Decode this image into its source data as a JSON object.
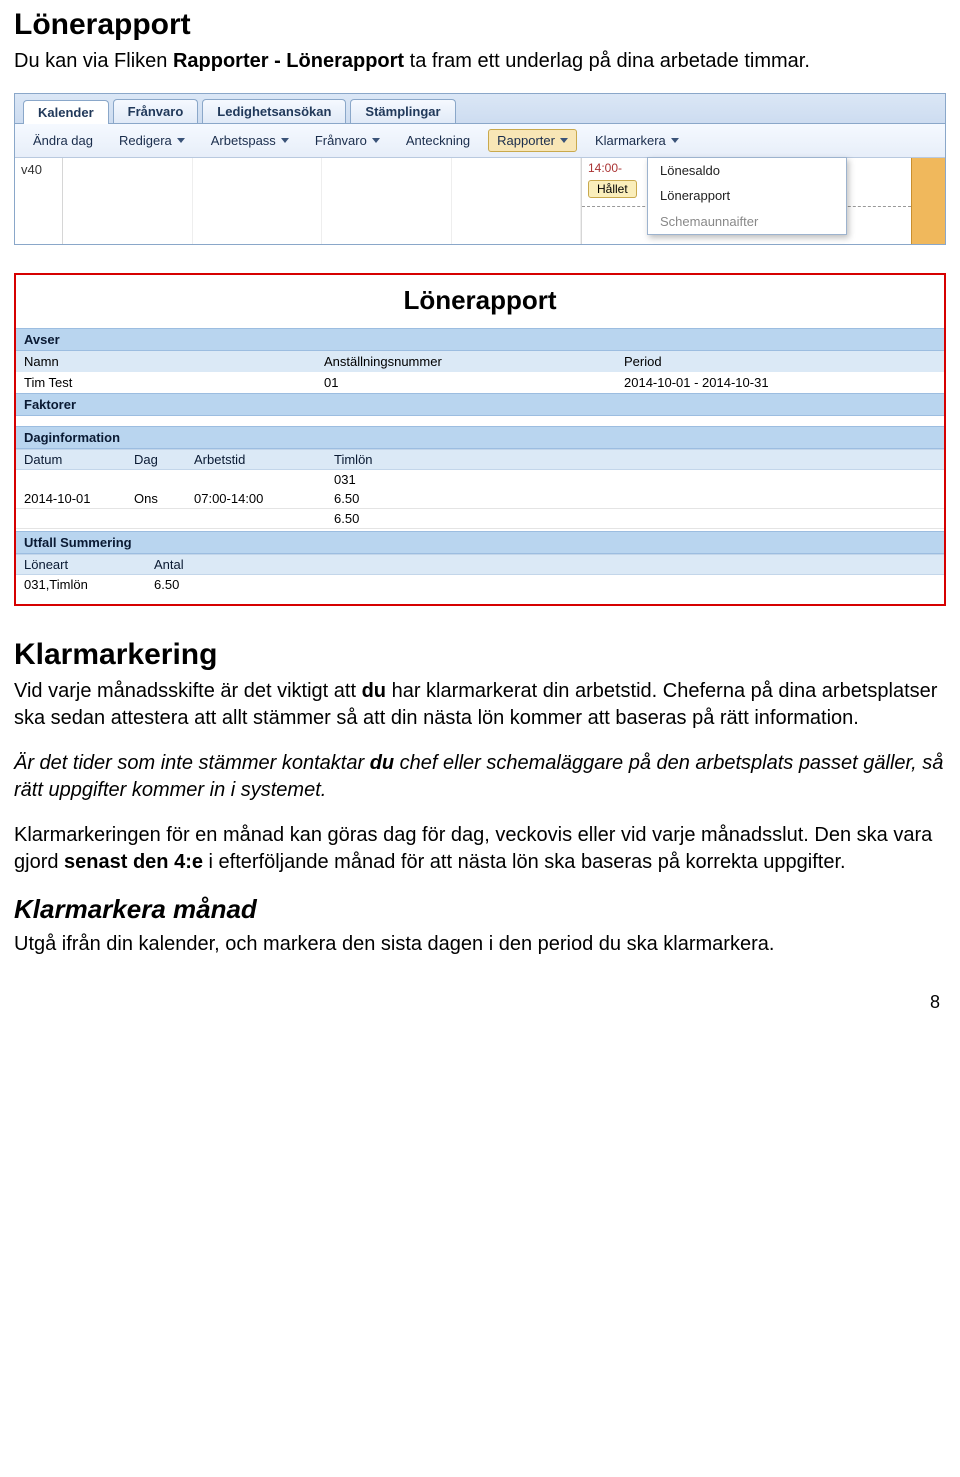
{
  "sections": {
    "lonerapport_h": "Lönerapport",
    "lonerapport_p1a": "Du kan via Fliken ",
    "lonerapport_p1b": "Rapporter - Lönerapport",
    "lonerapport_p1c": " ta fram ett underlag på dina arbetade timmar.",
    "klarmarkering_h": "Klarmarkering",
    "klar_p1a": "Vid varje månadsskifte är det viktigt att ",
    "klar_p1b": "du",
    "klar_p1c": " har klarmarkerat din arbetstid. Cheferna på dina arbetsplatser ska sedan attestera att allt stämmer så att din nästa lön kommer att baseras på rätt information.",
    "klar_p2a": "Är det tider som inte stämmer kontaktar ",
    "klar_p2b": "du",
    "klar_p2c": " chef eller schemaläggare på den arbetsplats passet gäller, så rätt uppgifter kommer in i systemet.",
    "klar_p3a": "Klarmarkeringen för en månad kan göras dag för dag, veckovis eller vid varje månadsslut. Den ska vara gjord ",
    "klar_p3b": "senast den 4:e",
    "klar_p3c": " i efterföljande månad för att nästa lön ska baseras på korrekta uppgifter.",
    "klarmanad_h": "Klarmarkera månad",
    "klarmanad_p": "Utgå ifrån din kalender, och markera den sista dagen i den period du ska klarmarkera."
  },
  "app1": {
    "tabs": [
      "Kalender",
      "Frånvaro",
      "Ledighetsansökan",
      "Stämplingar"
    ],
    "toolbar": [
      "Ändra dag",
      "Redigera",
      "Arbetspass",
      "Frånvaro",
      "Anteckning",
      "Rapporter",
      "Klarmarkera"
    ],
    "toolbar_caret": [
      false,
      true,
      true,
      true,
      false,
      true,
      true
    ],
    "toolbar_active_index": 5,
    "week": "v40",
    "time": "14:00-",
    "tag": "Hållet",
    "dropdown": [
      "Lönesaldo",
      "Lönerapport",
      "Schemaunnaifter"
    ]
  },
  "report": {
    "title": "Lönerapport",
    "avser": "Avser",
    "headers1": [
      "Namn",
      "Anställningsnummer",
      "Period"
    ],
    "row1": [
      "Tim Test",
      "01",
      "2014-10-01 - 2014-10-31"
    ],
    "faktorer": "Faktorer",
    "daginfo": "Daginformation",
    "dagheaders": [
      "Datum",
      "Dag",
      "Arbetstid",
      "Timlön"
    ],
    "dagrow0": [
      "",
      "",
      "",
      "031"
    ],
    "dagrow1": [
      "2014-10-01",
      "Ons",
      "07:00-14:00",
      "6.50"
    ],
    "dagrow2": [
      "",
      "",
      "",
      "6.50"
    ],
    "utfall": "Utfall Summering",
    "utheaders": [
      "Löneart",
      "Antal"
    ],
    "utrow": [
      "031,Timlön",
      "6.50"
    ]
  },
  "pagenum": "8"
}
